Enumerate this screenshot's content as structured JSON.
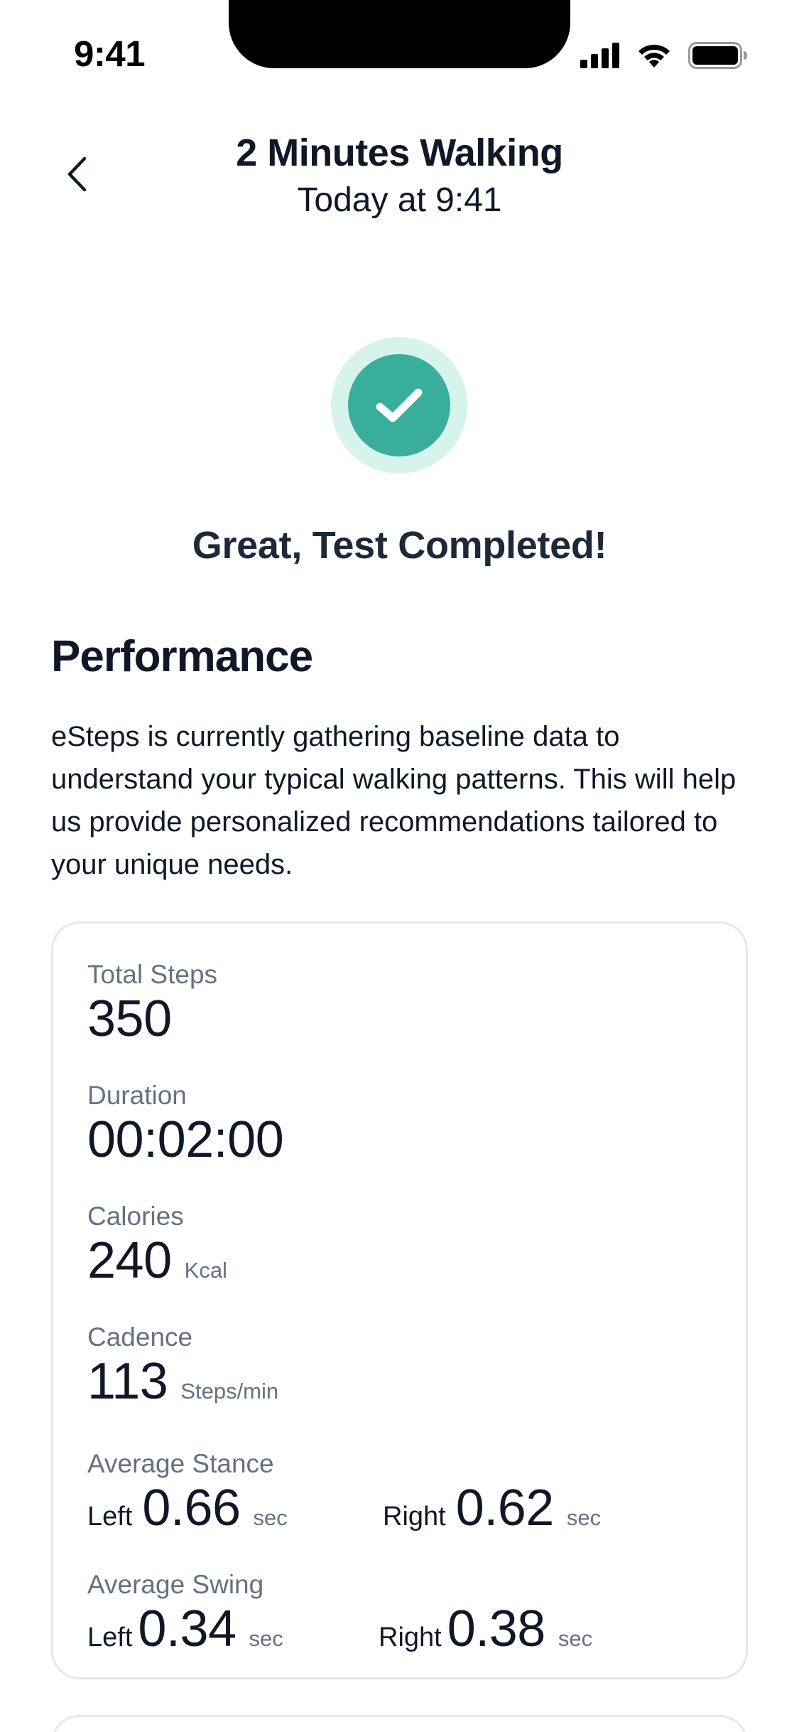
{
  "status_bar": {
    "time": "9:41",
    "icons": [
      "cellular-signal-icon",
      "wifi-icon",
      "battery-icon"
    ]
  },
  "header": {
    "back_icon": "chevron-left-icon",
    "title": "2 Minutes Walking",
    "subtitle": "Today at 9:41"
  },
  "success": {
    "icon": "checkmark-icon",
    "message": "Great, Test Completed!"
  },
  "performance": {
    "title": "Performance",
    "description": "eSteps is currently gathering baseline data to understand your typical walking patterns. This will help us provide personalized recommendations tailored to your unique needs."
  },
  "metrics": {
    "total_steps": {
      "label": "Total Steps",
      "value": "350"
    },
    "duration": {
      "label": "Duration",
      "value": "00:02:00"
    },
    "calories": {
      "label": "Calories",
      "value": "240",
      "unit": "Kcal"
    },
    "cadence": {
      "label": "Cadence",
      "value": "113",
      "unit": "Steps/min"
    },
    "average_stance": {
      "label": "Average Stance",
      "left_label": "Left",
      "left_value": "0.66",
      "left_unit": "sec",
      "right_label": "Right",
      "right_value": "0.62",
      "right_unit": "sec"
    },
    "average_swing": {
      "label": "Average Swing",
      "left_label": "Left",
      "left_value": "0.34",
      "left_unit": "sec",
      "right_label": "Right",
      "right_value": "0.38",
      "right_unit": "sec"
    }
  },
  "colors": {
    "accent": "#3aae9d",
    "accent_light": "#d6f3ec",
    "text_primary": "#101828",
    "text_secondary": "#667085",
    "card_border": "#e4e7ec"
  }
}
